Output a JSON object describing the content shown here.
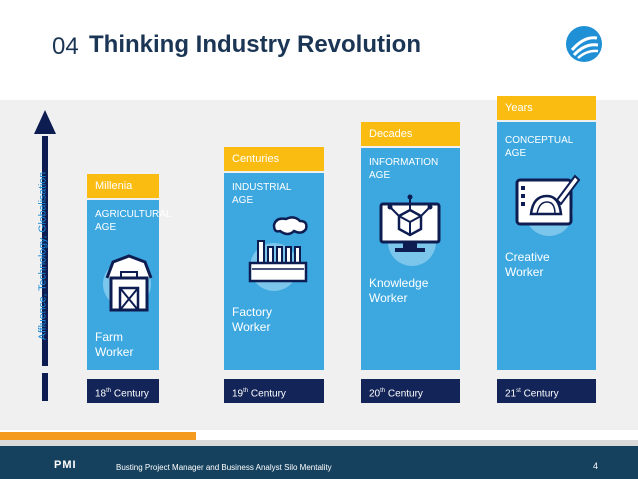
{
  "slide": {
    "number_prefix": "04",
    "title": "Thinking Industry Revolution",
    "vertical_label": "Affluence, Technology, Globalisation",
    "footer_text": "Busting Project Manager and Business Analyst Silo Mentality",
    "page_number": "4",
    "pmi_logo_text": "PMI"
  },
  "columns": [
    {
      "tab": "Millenia",
      "age": [
        "AGRICULTURAL",
        "AGE"
      ],
      "worker": [
        "Farm",
        "Worker"
      ],
      "century_num": "18",
      "century_sup": "th",
      "century_word": " Century",
      "icon": "barn-icon"
    },
    {
      "tab": "Centuries",
      "age": [
        "INDUSTRIAL",
        "AGE"
      ],
      "worker": [
        "Factory",
        "Worker"
      ],
      "century_num": "19",
      "century_sup": "th",
      "century_word": " Century",
      "icon": "factory-icon"
    },
    {
      "tab": "Decades",
      "age": [
        "INFORMATION",
        "AGE"
      ],
      "worker": [
        "Knowledge",
        "Worker"
      ],
      "century_num": "20",
      "century_sup": "th",
      "century_word": " Century",
      "icon": "computer-cube-icon"
    },
    {
      "tab": "Years",
      "age": [
        "CONCEPTUAL",
        "AGE"
      ],
      "worker": [
        "Creative",
        "Worker"
      ],
      "century_num": "21",
      "century_sup": "st",
      "century_word": " Century",
      "icon": "design-tablet-icon"
    }
  ],
  "colors": {
    "title": "#1b3554",
    "tab": "#fbbc12",
    "card": "#3da8e0",
    "century": "#132558",
    "arrow": "#0d1d52",
    "footer": "#15415e",
    "accent_orange": "#f39a1f"
  }
}
